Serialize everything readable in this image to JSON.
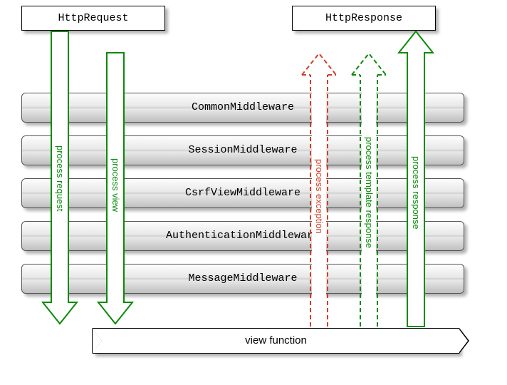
{
  "top": {
    "request": "HttpRequest",
    "response": "HttpResponse"
  },
  "middlewares": [
    "CommonMiddleware",
    "SessionMiddleware",
    "CsrfViewMiddleware",
    "AuthenticationMiddleware",
    "MessageMiddleware"
  ],
  "view_label": "view function",
  "arrows": {
    "process_request": "process request",
    "process_view": "process view",
    "process_exception": "process exception",
    "process_template_response": "process template response",
    "process_response": "process response"
  },
  "colors": {
    "green": "#0a8a0a",
    "red": "#d43d2a"
  }
}
